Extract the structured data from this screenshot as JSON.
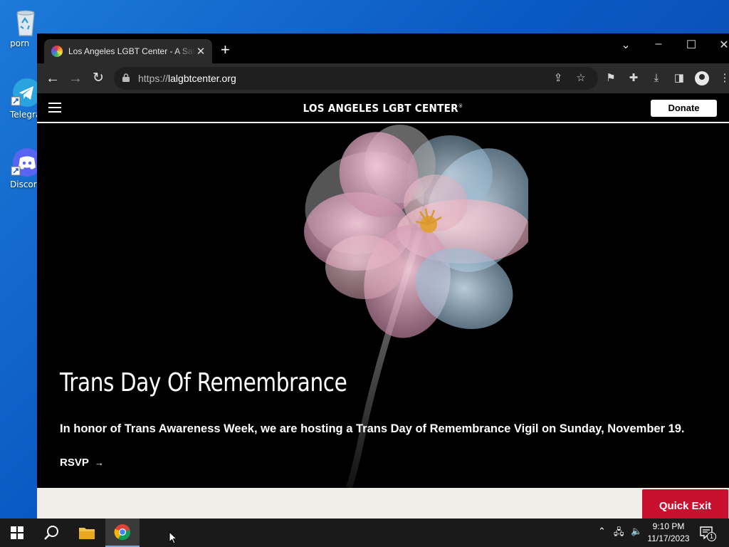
{
  "desktop": {
    "icons": [
      {
        "label": "porn",
        "icon": "recycle-bin-icon"
      },
      {
        "label": "Telegra",
        "icon": "telegram-icon"
      },
      {
        "label": "Discor",
        "icon": "discord-icon"
      }
    ]
  },
  "browser": {
    "tab_title": "Los Angeles LGBT Center - A Safe",
    "url_prefix": "https://",
    "url_domain": "lalgbtcenter.org"
  },
  "site": {
    "logo": "LOS ANGELES LGBT CENTER",
    "logo_mark": "®",
    "donate_label": "Donate",
    "hero": {
      "title": "Trans Day Of Remembrance",
      "text": "In honor of Trans Awareness Week, we are hosting a Trans Day of Remembrance Vigil on Sunday, November 19.",
      "cta": "RSVP"
    },
    "quick_exit_label": "Quick Exit"
  },
  "taskbar": {
    "time": "9:10 PM",
    "date": "11/17/2023",
    "notification_count": "1"
  },
  "colors": {
    "quick_exit": "#c8102e",
    "chrome_toolbar": "#2b2b2b",
    "desktop": "#0a58c2"
  }
}
